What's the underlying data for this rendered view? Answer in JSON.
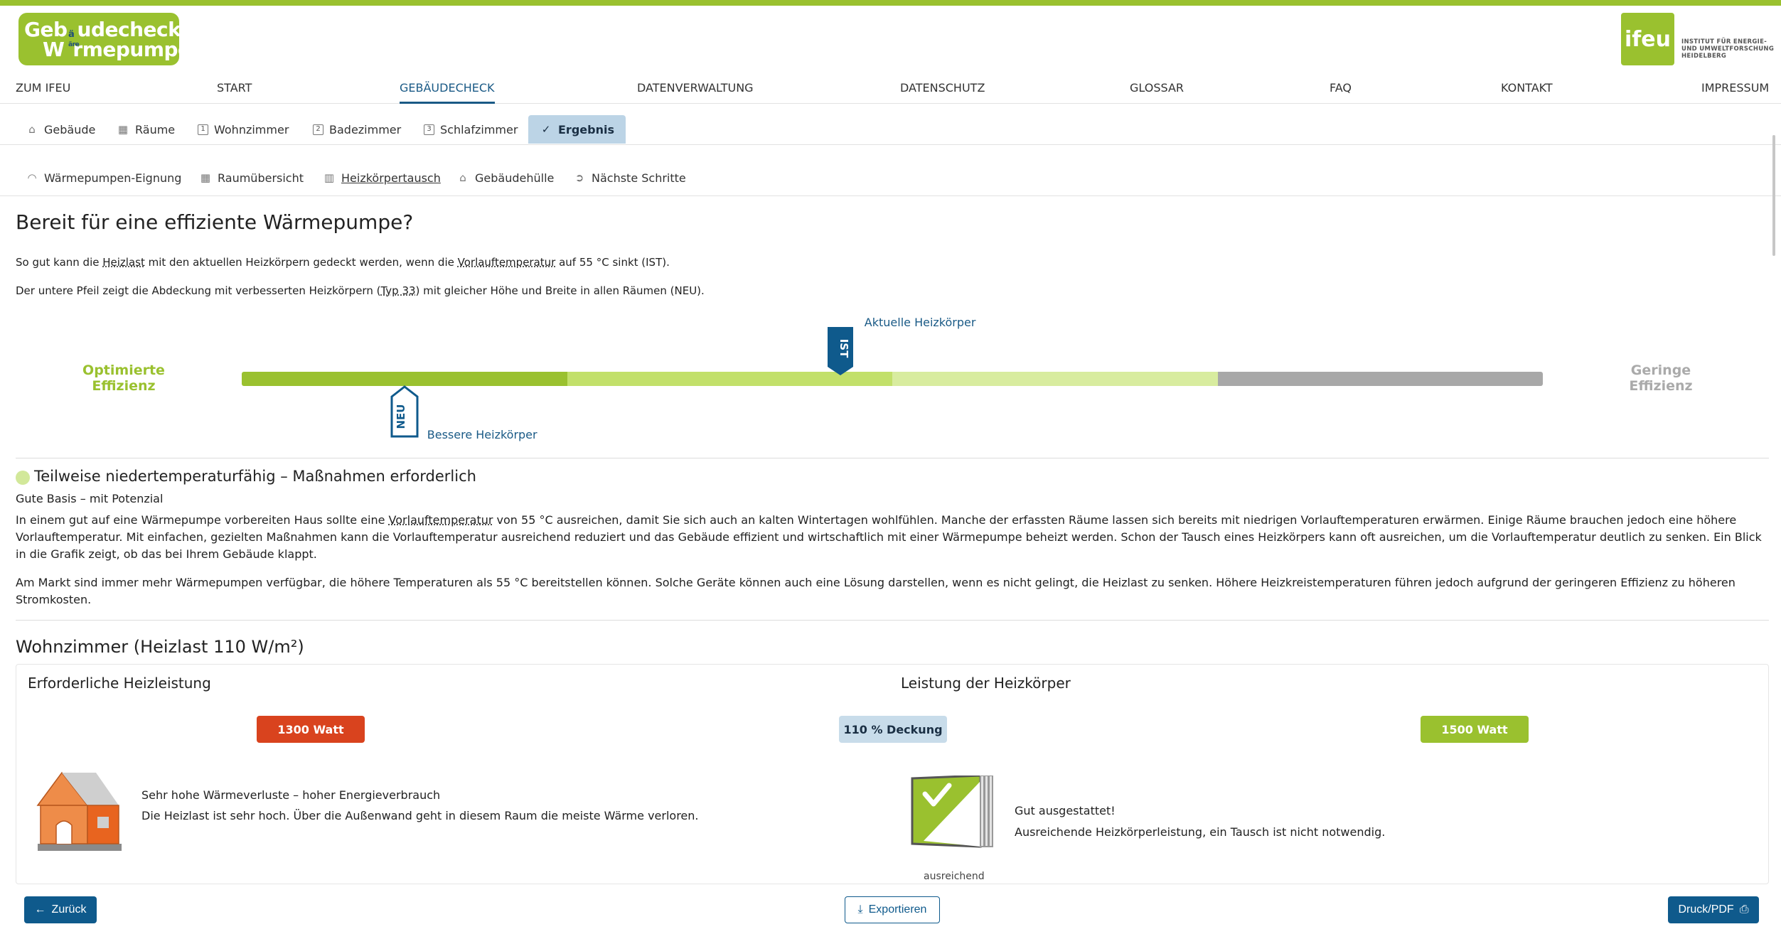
{
  "brand": {
    "logo_line1": "Geb",
    "logo_line1b": "udecheck",
    "logo_mid": "ä",
    "logo_line2": "W",
    "logo_line2b": "rmepumpe",
    "logo_mid2": "äre",
    "ifeu_badge": "ifeu",
    "ifeu_inst_line1": "INSTITUT FÜR ENERGIE-",
    "ifeu_inst_line2": "UND UMWELTFORSCHUNG",
    "ifeu_inst_line3": "HEIDELBERG",
    "accent": "#9ac12f",
    "primary": "#0f5a8c"
  },
  "main_nav": [
    {
      "label": "ZUM IFEU"
    },
    {
      "label": "START"
    },
    {
      "label": "GEBÄUDECHECK"
    },
    {
      "label": "DATENVERWALTUNG"
    },
    {
      "label": "DATENSCHUTZ"
    },
    {
      "label": "GLOSSAR"
    },
    {
      "label": "FAQ"
    },
    {
      "label": "KONTAKT"
    },
    {
      "label": "IMPRESSUM"
    }
  ],
  "steps": [
    {
      "label": "Gebäude",
      "icon": "house-icon"
    },
    {
      "label": "Räume",
      "icon": "grid-icon"
    },
    {
      "label": "Wohnzimmer",
      "icon": "1"
    },
    {
      "label": "Badezimmer",
      "icon": "2"
    },
    {
      "label": "Schlafzimmer",
      "icon": "3"
    },
    {
      "label": "Ergebnis",
      "icon": "check-circle-icon"
    }
  ],
  "result_tabs": [
    {
      "label": "Wärmepumpen-Eignung",
      "icon": "gauge-icon"
    },
    {
      "label": "Raumübersicht",
      "icon": "grid-icon"
    },
    {
      "label": "Heizkörpertausch",
      "icon": "radiator-icon"
    },
    {
      "label": "Gebäudehülle",
      "icon": "house-icon"
    },
    {
      "label": "Nächste Schritte",
      "icon": "arrow-circle-icon"
    }
  ],
  "page": {
    "title": "Bereit für eine effiziente Wärmepumpe?",
    "p1_a": "So gut kann die ",
    "p1_link1": "Heizlast",
    "p1_b": " mit den aktuellen Heizkörpern gedeckt werden, wenn die ",
    "p1_link2": "Vorlauftemperatur",
    "p1_c": " auf 55 °C sinkt (IST).",
    "p2_a": "Der untere Pfeil zeigt die Abdeckung mit verbesserten Heizkörpern (",
    "p2_link": "Typ 33",
    "p2_b": ") mit gleicher Höhe und Breite in allen Räumen (NEU)."
  },
  "scale": {
    "left_label_1": "Optimierte",
    "left_label_2": "Effizienz",
    "right_label_1": "Geringe",
    "right_label_2": "Effizienz",
    "segments": [
      "#9ac12f",
      "#c2e06a",
      "#d8ec9f",
      "#a8a8a8"
    ],
    "ist_tag": "IST",
    "ist_label": "Aktuelle Heizkörper",
    "ist_position": 0.46,
    "neu_tag": "NEU",
    "neu_label": "Bessere Heizkörper",
    "neu_position": 0.125
  },
  "status": {
    "title": "Teilweise niedertemperaturfähig – Maßnahmen erforderlich",
    "subtitle": "Gute Basis – mit Potenzial",
    "text1_a": "In einem gut auf eine Wärmepumpe vorbereiten Haus sollte eine ",
    "text1_link": "Vorlauftemperatur",
    "text1_b": " von 55 °C ausreichen, damit Sie sich auch an kalten Wintertagen wohlfühlen. Manche der erfassten Räume lassen sich bereits mit niedrigen Vorlauftemperaturen erwärmen. Einige Räume brauchen jedoch eine höhere Vorlauftemperatur. Mit einfachen, gezielten Maßnahmen kann die Vorlauftemperatur ausreichend reduziert und das Gebäude effizient und wirtschaftlich mit einer Wärmepumpe beheizt werden. Schon der Tausch eines Heizkörpers kann oft ausreichen, um die Vorlauftemperatur deutlich zu senken. Ein Blick in die Grafik zeigt, ob das bei Ihrem Gebäude klappt.",
    "text2": "Am Markt sind immer mehr Wärmepumpen verfügbar, die höhere Temperaturen als 55 °C bereitstellen können. Solche Geräte können auch eine Lösung darstellen, wenn es nicht gelingt, die Heizlast zu senken. Höhere Heizkreistemperaturen führen jedoch aufgrund der geringeren Effizienz zu höheren Stromkosten."
  },
  "room": {
    "title": "Wohnzimmer (Heizlast 110 W/m²)",
    "left_heading": "Erforderliche Heizleistung",
    "right_heading": "Leistung der Heizkörper",
    "required_watt": "1300 Watt",
    "coverage": "110 % Deckung",
    "radiator_watt": "1500 Watt",
    "left_info_title": "Sehr hohe Wärmeverluste – hoher Energieverbrauch",
    "left_info_text": "Die Heizlast ist sehr hoch. Über die Außenwand geht in diesem Raum die meiste Wärme verloren.",
    "right_info_title": "Gut ausgestattet!",
    "right_info_text": "Ausreichende Heizkörperleistung, ein Tausch ist nicht notwendig.",
    "radiator_caption": "ausreichend",
    "colors": {
      "required": "#d9431e",
      "coverage": "#c8dcea",
      "radiator": "#9ac12f"
    }
  },
  "footer": {
    "back": "Zurück",
    "export": "Exportieren",
    "print": "Druck/PDF"
  }
}
